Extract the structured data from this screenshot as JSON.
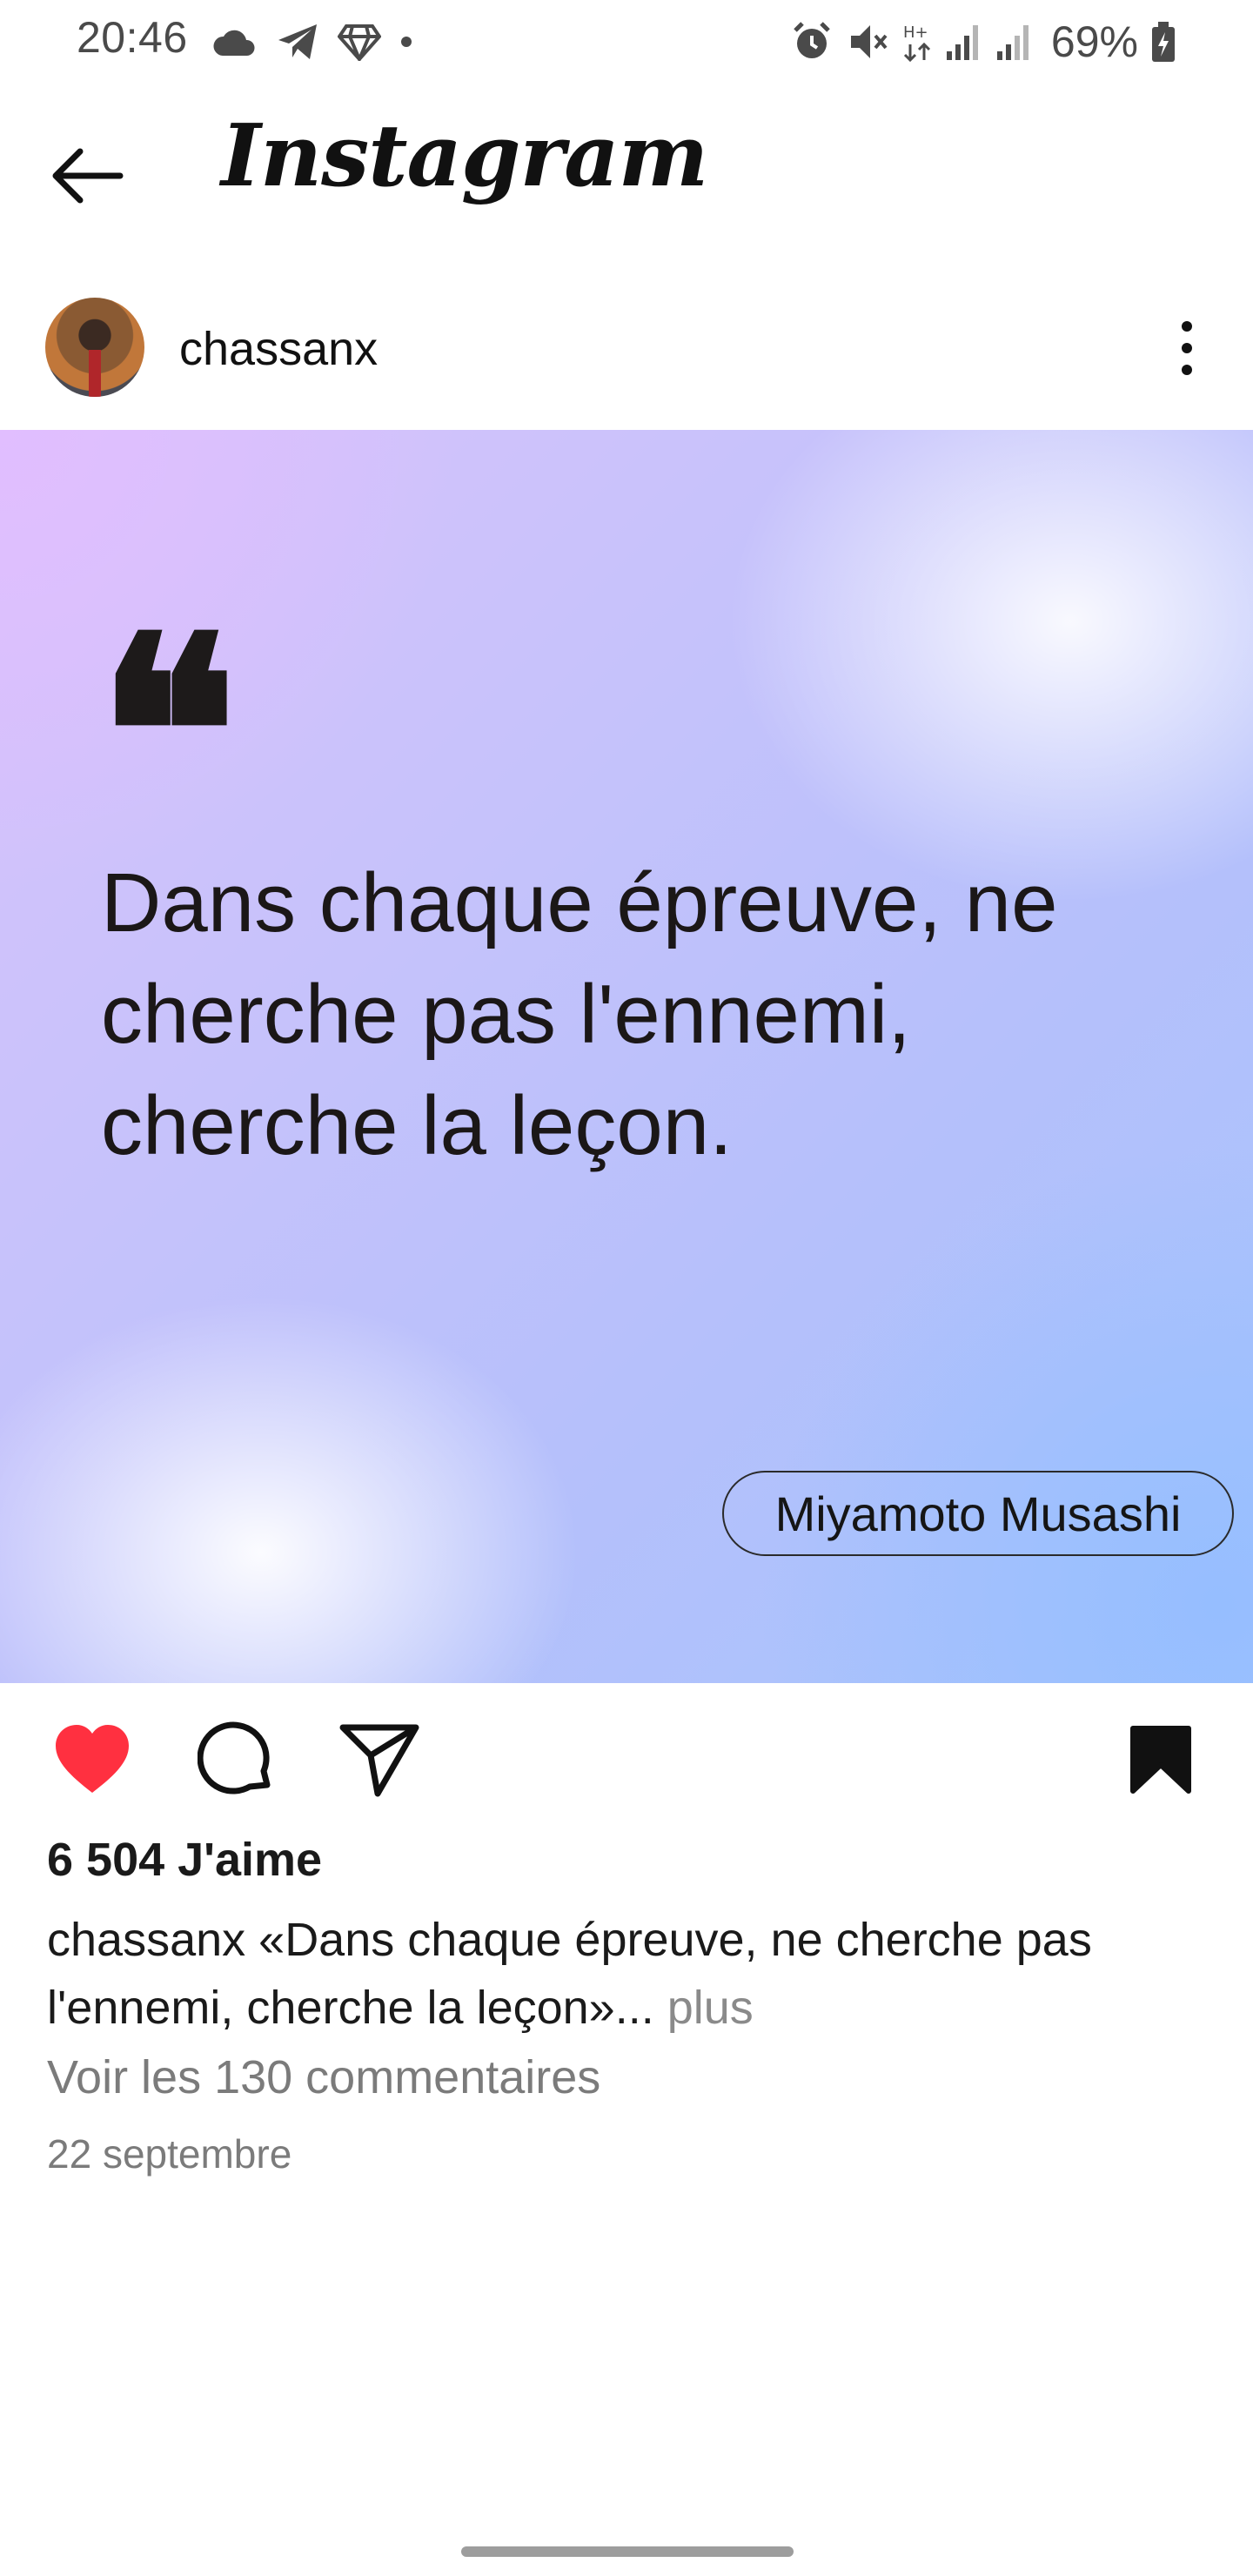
{
  "status_bar": {
    "time": "20:46",
    "battery": "69%",
    "left_icons": [
      "cloud-icon",
      "telegram-icon",
      "diamond-icon",
      "dot-icon"
    ],
    "right_icons": [
      "alarm-icon",
      "mute-icon",
      "data-icon",
      "signal-icon",
      "signal-icon",
      "battery-icon"
    ]
  },
  "header": {
    "title": "Instagram"
  },
  "post": {
    "username": "chassanx",
    "quote_mark": "❝",
    "quote_lines": [
      "Dans chaque épreuve, ne",
      "cherche pas l'ennemi,",
      "cherche la leçon."
    ],
    "author": "Miyamoto Musashi",
    "likes": "6 504 J'aime",
    "caption_user": "chassanx",
    "caption_text": "«Dans chaque épreuve, ne cherche pas l'ennemi, cherche la leçon»",
    "caption_ellipsis": "...",
    "caption_more": "plus",
    "view_comments": "Voir les 130 commentaires",
    "date": "22 septembre"
  },
  "colors": {
    "like_red": "#ff3040",
    "text_dark": "#111111",
    "text_muted": "#7b7b7b"
  }
}
